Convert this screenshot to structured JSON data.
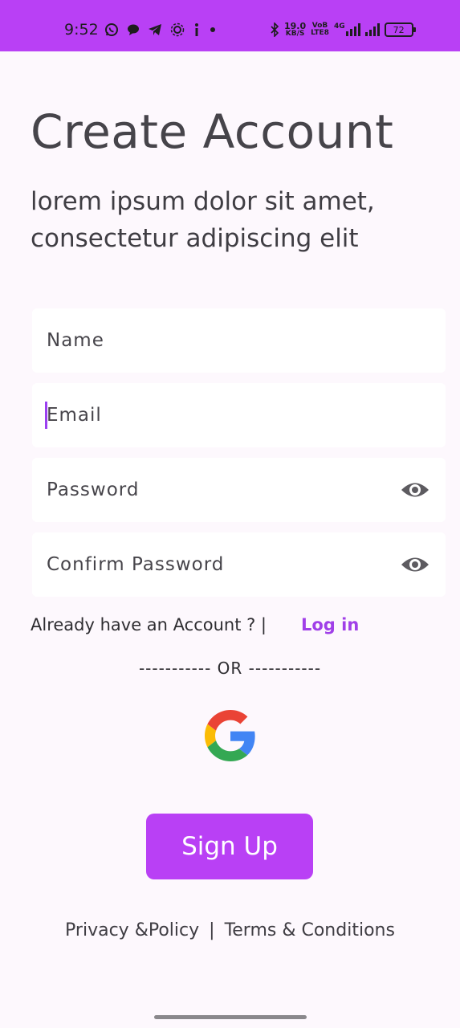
{
  "status_bar": {
    "time": "9:52",
    "left_icons": [
      "whatsapp-icon",
      "chat-icon",
      "telegram-icon",
      "app-icon",
      "info-icon",
      "dot-icon"
    ],
    "net_speed_value": "19.0",
    "net_speed_unit": "KB/S",
    "volte_top": "VoB",
    "volte_bottom": "LTE8",
    "network_label": "4G",
    "battery_level": "72",
    "background_color": "#b940f5"
  },
  "header": {
    "title": "Create Account",
    "subtitle": "lorem ipsum dolor sit amet, consectetur adipiscing elit"
  },
  "form": {
    "name_placeholder": "Name",
    "email_placeholder": "Email",
    "password_placeholder": "Password",
    "confirm_password_placeholder": "Confirm Password",
    "focused_field": "email"
  },
  "login_prompt": {
    "text": "Already have an Account ? |",
    "link_label": "Log in"
  },
  "divider": {
    "text": "----------- OR -----------"
  },
  "social": {
    "google_icon": "google-icon"
  },
  "actions": {
    "signup_label": "Sign Up",
    "accent_color": "#b940f5"
  },
  "footer": {
    "privacy_label": "Privacy &Policy",
    "separator": "|",
    "terms_label": "Terms & Conditions"
  }
}
